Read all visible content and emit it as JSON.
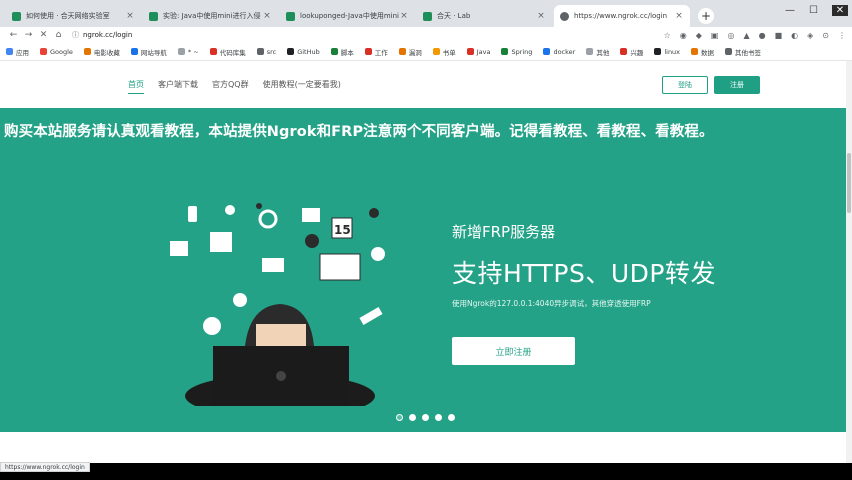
{
  "browser": {
    "tabs": [
      {
        "title": "如何使用 · 合天网络实验室",
        "active": false
      },
      {
        "title": "实验: Java中使用mini进行入侵",
        "active": false
      },
      {
        "title": "lookuponged-Java中使用mini中",
        "active": false
      },
      {
        "title": "合天 · Lab",
        "active": false
      },
      {
        "title": "https://www.ngrok.cc/login",
        "active": true
      }
    ],
    "new_tab_label": "+",
    "window_controls": {
      "minimize": "—",
      "maximize": "☐",
      "close": "✕"
    },
    "url": "ngrok.cc/login",
    "nav": {
      "back": "←",
      "forward": "→",
      "reload": "✕",
      "home": "⌂"
    },
    "bookmarks": [
      {
        "label": "应用",
        "color": "#4285f4"
      },
      {
        "label": "Google",
        "color": "#ea4335"
      },
      {
        "label": "电影收藏",
        "color": "#e37400"
      },
      {
        "label": "网站导航",
        "color": "#1a73e8"
      },
      {
        "label": "* ~",
        "color": "#9aa0a6"
      },
      {
        "label": "代码库集",
        "color": "#d93025"
      },
      {
        "label": "src",
        "color": "#5f6368"
      },
      {
        "label": "GitHub",
        "color": "#202124"
      },
      {
        "label": "脚本",
        "color": "#188038"
      },
      {
        "label": "工作",
        "color": "#d93025"
      },
      {
        "label": "漏洞",
        "color": "#e37400"
      },
      {
        "label": "书单",
        "color": "#f29900"
      },
      {
        "label": "Java",
        "color": "#d93025"
      },
      {
        "label": "Spring",
        "color": "#188038"
      },
      {
        "label": "docker",
        "color": "#1a73e8"
      },
      {
        "label": "其他",
        "color": "#9aa0a6"
      },
      {
        "label": "兴趣",
        "color": "#d93025"
      },
      {
        "label": "linux",
        "color": "#202124"
      },
      {
        "label": "数据",
        "color": "#e37400"
      },
      {
        "label": "其他书签",
        "color": "#5f6368"
      }
    ],
    "status_url": "https://www.ngrok.cc/login"
  },
  "site": {
    "nav": [
      {
        "label": "首页",
        "active": true
      },
      {
        "label": "客户端下载",
        "active": false
      },
      {
        "label": "官方QQ群",
        "active": false
      },
      {
        "label": "使用教程(一定要看我)",
        "active": false
      }
    ],
    "login_label": "登陆",
    "register_label": "注册"
  },
  "hero": {
    "notice": "购买本站服务请认真观看教程，本站提供Ngrok和FRP注意两个不同客户端。记得看教程、看教程、看教程。",
    "kicker": "新增FRP服务器",
    "title": "支持HTTPS、UDP转发",
    "subtitle": "使用Ngrok的127.0.0.1:4040异步调试，其他穿透使用FRP",
    "cta_label": "立即注册",
    "calendar_day": "15",
    "slides": 5,
    "active_slide": 0
  },
  "colors": {
    "brand": "#1fa085",
    "hero_bg": "#23a287"
  }
}
